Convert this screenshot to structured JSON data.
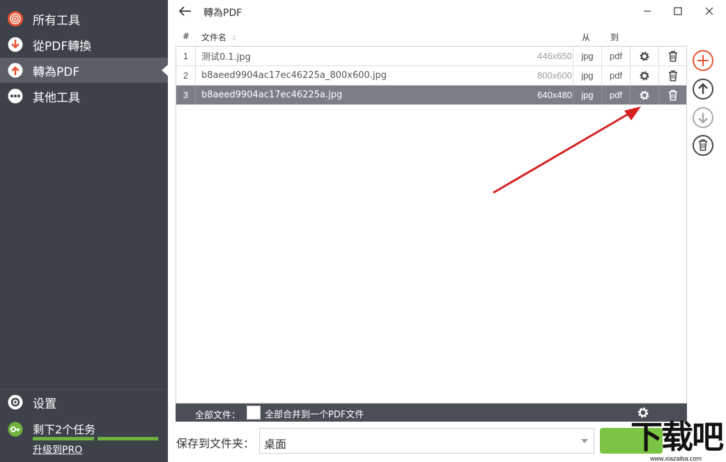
{
  "sidebar": {
    "items": [
      {
        "label": "所有工具",
        "icon": "target-icon",
        "active": false
      },
      {
        "label": "從PDF轉換",
        "icon": "arrow-down-circle-icon",
        "active": false
      },
      {
        "label": "轉為PDF",
        "icon": "arrow-up-circle-icon",
        "active": true
      },
      {
        "label": "其他工具",
        "icon": "more-dots-icon",
        "active": false
      }
    ],
    "settings_label": "设置",
    "tasks_label": "剩下2个任务",
    "upgrade_label": "升级到PRO"
  },
  "titlebar": {
    "title": "轉為PDF"
  },
  "table": {
    "headers": {
      "num": "#",
      "name": "文件名",
      "from": "从",
      "to": "到"
    },
    "rows": [
      {
        "num": "1",
        "name": "测试0.1.jpg",
        "size": "446x650",
        "from": "jpg",
        "to": "pdf",
        "selected": false
      },
      {
        "num": "2",
        "name": "b8aeed9904ac17ec46225a_800x600.jpg",
        "size": "800x600",
        "from": "jpg",
        "to": "pdf",
        "selected": false
      },
      {
        "num": "3",
        "name": "b8aeed9904ac17ec46225a.jpg",
        "size": "640x480",
        "from": "jpg",
        "to": "pdf",
        "selected": true
      }
    ]
  },
  "bottom_bar": {
    "all_files_label": "全部文件：",
    "merge_label": "全部合并到一个PDF文件"
  },
  "save": {
    "label": "保存到文件夹：",
    "value": "桌面"
  },
  "watermark": {
    "big": "下载吧",
    "small": "www.xiazaiba.com"
  },
  "colors": {
    "sidebar_bg": "#3d424a",
    "accent_green": "#7cc443",
    "accent_red": "#e8512f",
    "selected_row": "#7a7f87"
  }
}
